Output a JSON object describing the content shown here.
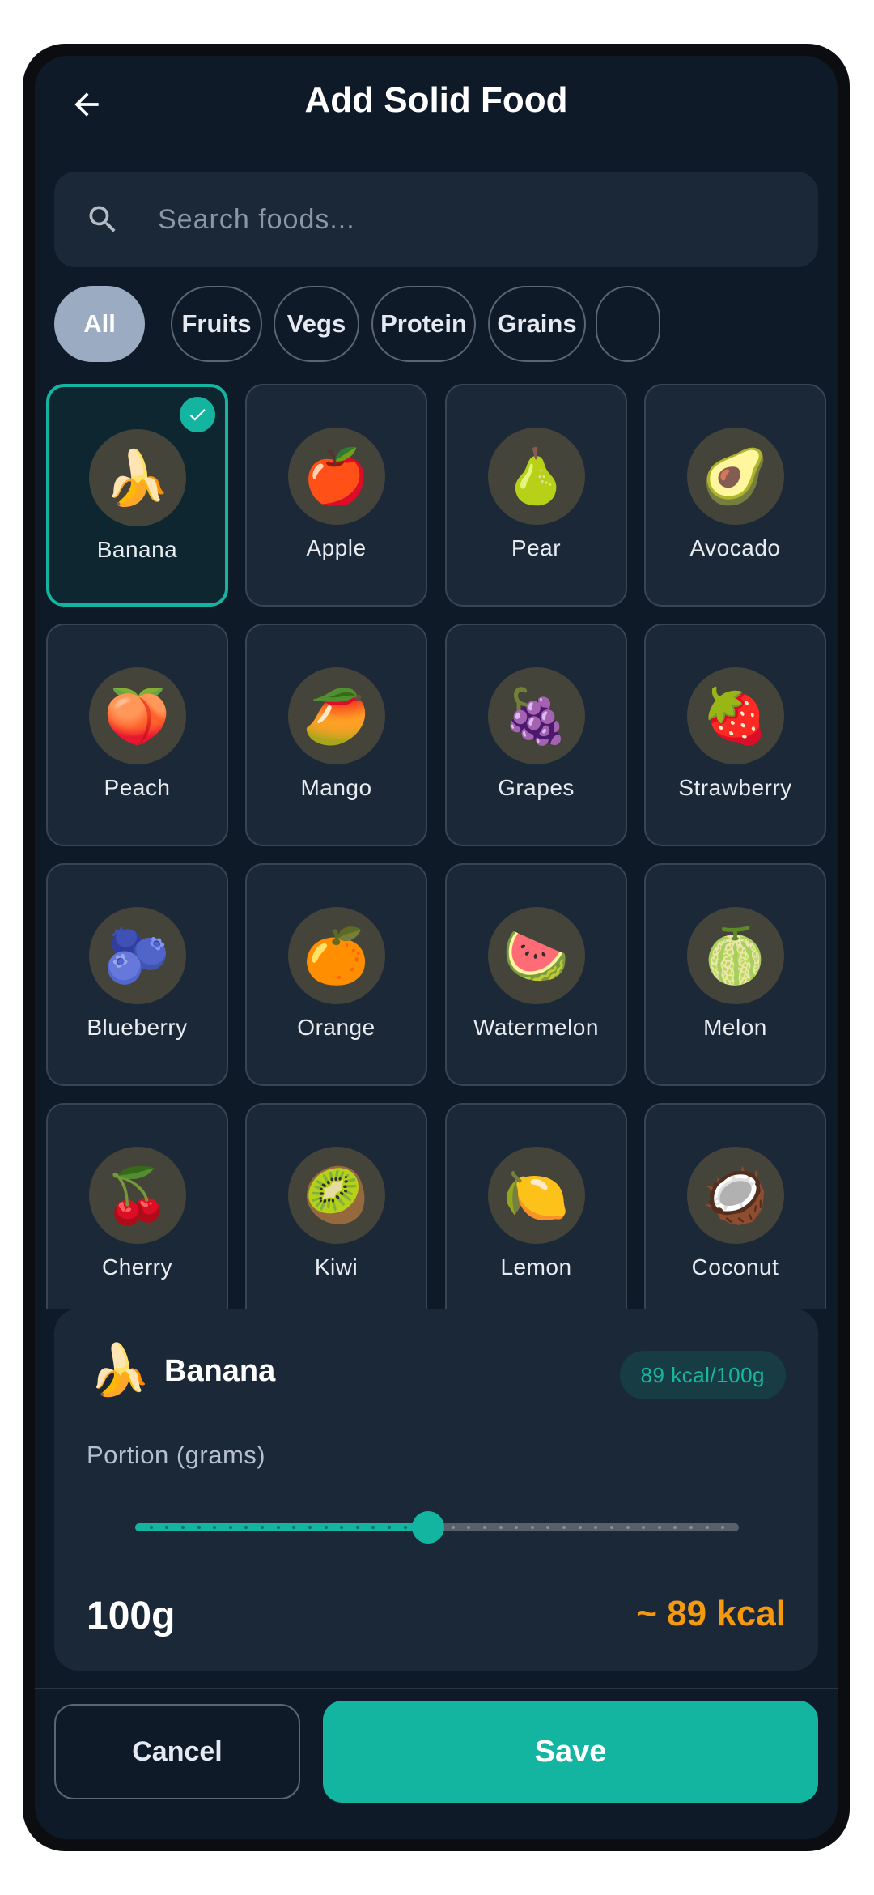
{
  "header": {
    "title": "Add Solid Food"
  },
  "search": {
    "placeholder": "Search foods..."
  },
  "filters": {
    "chips": [
      {
        "label": "All",
        "active": true
      },
      {
        "label": "Fruits",
        "active": false
      },
      {
        "label": "Vegs",
        "active": false
      },
      {
        "label": "Protein",
        "active": false
      },
      {
        "label": "Grains",
        "active": false
      },
      {
        "label": "",
        "active": false
      }
    ]
  },
  "foods": [
    {
      "name": "Banana",
      "emoji": "🍌",
      "selected": true
    },
    {
      "name": "Apple",
      "emoji": "🍎",
      "selected": false
    },
    {
      "name": "Pear",
      "emoji": "🍐",
      "selected": false
    },
    {
      "name": "Avocado",
      "emoji": "🥑",
      "selected": false
    },
    {
      "name": "Peach",
      "emoji": "🍑",
      "selected": false
    },
    {
      "name": "Mango",
      "emoji": "🥭",
      "selected": false
    },
    {
      "name": "Grapes",
      "emoji": "🍇",
      "selected": false
    },
    {
      "name": "Strawberry",
      "emoji": "🍓",
      "selected": false
    },
    {
      "name": "Blueberry",
      "emoji": "🫐",
      "selected": false
    },
    {
      "name": "Orange",
      "emoji": "🍊",
      "selected": false
    },
    {
      "name": "Watermelon",
      "emoji": "🍉",
      "selected": false
    },
    {
      "name": "Melon",
      "emoji": "🍈",
      "selected": false
    },
    {
      "name": "Cherry",
      "emoji": "🍒",
      "selected": false
    },
    {
      "name": "Kiwi",
      "emoji": "🥝",
      "selected": false
    },
    {
      "name": "Lemon",
      "emoji": "🍋",
      "selected": false
    },
    {
      "name": "Coconut",
      "emoji": "🥥",
      "selected": false
    }
  ],
  "selected_food": {
    "name": "Banana",
    "emoji": "🍌",
    "kcal_badge": "89 kcal/100g",
    "portion_label": "Portion (grams)",
    "portion_value": "100g",
    "kcal_total": "~ 89 kcal",
    "slider_fraction": 0.485
  },
  "actions": {
    "cancel_label": "Cancel",
    "save_label": "Save"
  },
  "colors": {
    "accent": "#13b5a0",
    "calorie": "#f59a0e",
    "background": "#0f1a28",
    "card": "#1b2838",
    "active_chip": "#9aabc2"
  }
}
